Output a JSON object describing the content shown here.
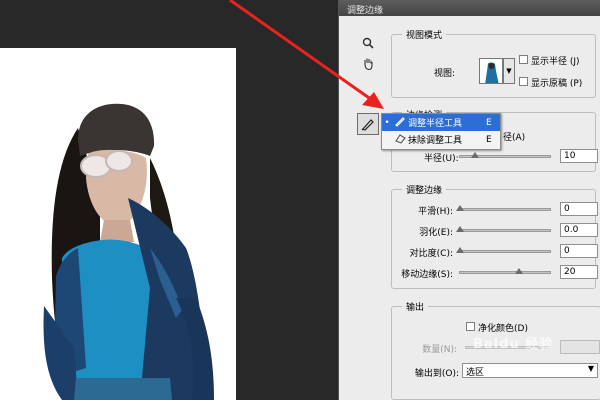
{
  "dialog": {
    "title": "调整边缘"
  },
  "tools": [
    {
      "icon": "zoom-icon"
    },
    {
      "icon": "hand-icon"
    }
  ],
  "view_mode": {
    "section_title": "视图模式",
    "view_label": "视图:",
    "show_radius_label": "显示半径 (J)",
    "show_original_label": "显示原稿 (P)"
  },
  "tool_popup": {
    "items": [
      {
        "label": "调整半径工具",
        "shortcut": "E"
      },
      {
        "label": "抹除调整工具",
        "shortcut": "E"
      }
    ]
  },
  "edge_detection": {
    "title_partial": "边缘检测",
    "smart_radius_partial": "径(A)",
    "radius_label": "半径(U):",
    "radius_value": "10"
  },
  "adjust_edge": {
    "section_title": "调整边缘",
    "rows": [
      {
        "label": "平滑(H):",
        "value": "0"
      },
      {
        "label": "羽化(E):",
        "value": "0.0"
      },
      {
        "label": "对比度(C):",
        "value": "0"
      },
      {
        "label": "移动边缘(S):",
        "value": "20"
      }
    ]
  },
  "output": {
    "section_title": "输出",
    "decontaminate_label": "净化颜色(D)",
    "amount_label": "数量(N):",
    "output_to_label": "输出到(O):",
    "output_to_value": "选区"
  },
  "watermark": "Baidu 经验",
  "colors": {
    "arrow": "#e8231f",
    "selection": "#2a6fd6",
    "dialog_bg": "#ececec",
    "canvas_bg": "#282828"
  }
}
